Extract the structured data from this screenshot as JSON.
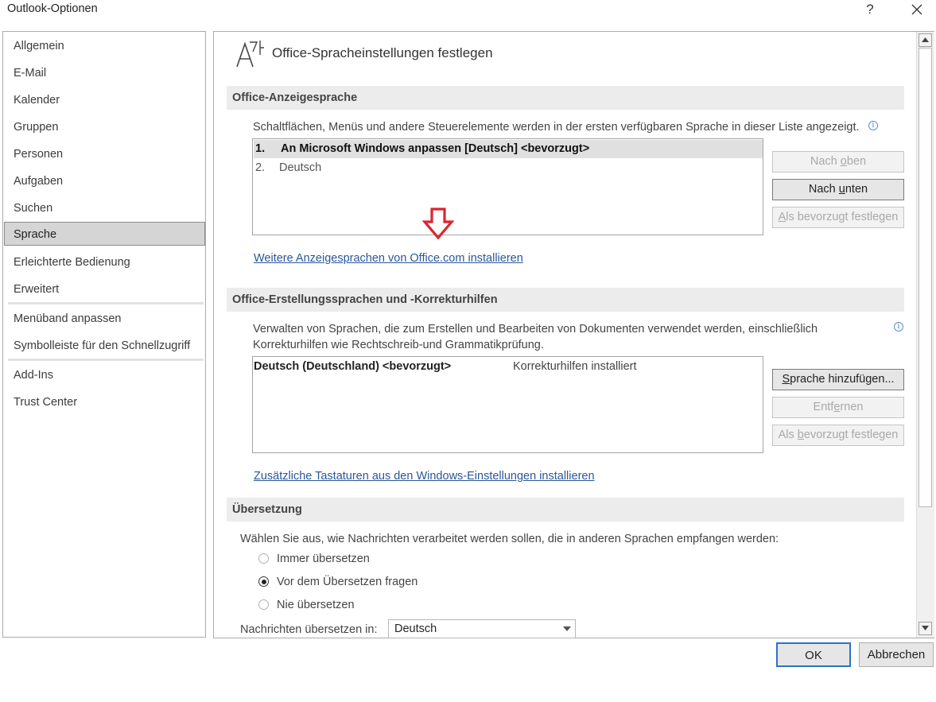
{
  "window": {
    "title": "Outlook-Optionen",
    "help_label": "?",
    "close_label": "✕"
  },
  "sidebar": {
    "items": [
      {
        "label": "Allgemein"
      },
      {
        "label": "E-Mail"
      },
      {
        "label": "Kalender"
      },
      {
        "label": "Gruppen"
      },
      {
        "label": "Personen"
      },
      {
        "label": "Aufgaben"
      },
      {
        "label": "Suchen"
      },
      {
        "label": "Sprache",
        "selected": true
      },
      {
        "label": "Erleichterte Bedienung"
      },
      {
        "label": "Erweitert"
      },
      {
        "label": "Menüband anpassen"
      },
      {
        "label": "Symbolleiste für den Schnellzugriff"
      },
      {
        "label": "Add-Ins"
      },
      {
        "label": "Trust Center"
      }
    ]
  },
  "page": {
    "icon": "language-icon",
    "icon_glyph": "A",
    "icon_glyph2": "ᄀ",
    "title": "Office-Spracheinstellungen festlegen"
  },
  "display_language": {
    "header": "Office-Anzeigesprache",
    "description": "Schaltflächen, Menüs und andere Steuerelemente werden in der ersten verfügbaren Sprache in dieser Liste angezeigt.",
    "info_glyph": "i",
    "list": [
      {
        "num": "1.",
        "label": "An Microsoft Windows anpassen [Deutsch] <bevorzugt>",
        "selected": true
      },
      {
        "num": "2.",
        "label": "Deutsch"
      }
    ],
    "btn_up": {
      "pre": "Nach ",
      "acc": "o",
      "post": "ben"
    },
    "btn_down": {
      "pre": "Nach ",
      "acc": "u",
      "post": "nten"
    },
    "btn_preferred": {
      "pre": "",
      "acc": "A",
      "post": "ls bevorzugt festlegen"
    },
    "link": "Weitere Anzeigesprachen von Office.com installieren",
    "arrow_color": "#d9262e"
  },
  "authoring_language": {
    "header": "Office-Erstellungssprachen und -Korrekturhilfen",
    "description_line1": "Verwalten von Sprachen, die zum Erstellen und Bearbeiten von Dokumenten verwendet werden, einschließlich",
    "description_line2": "Korrekturhilfen wie Rechtschreib-und Grammatikprüfung.",
    "list": [
      {
        "language": "Deutsch (Deutschland) <bevorzugt>",
        "status": "Korrekturhilfen installiert"
      }
    ],
    "btn_add": {
      "pre": "",
      "acc": "S",
      "post": "prache hinzufügen..."
    },
    "btn_remove": {
      "pre": "Entf",
      "acc": "e",
      "post": "rnen"
    },
    "btn_preferred": {
      "pre": "Als ",
      "acc": "b",
      "post": "evorzugt festlegen"
    },
    "link": "Zusätzliche Tastaturen aus den Windows-Einstellungen installieren"
  },
  "translation": {
    "header": "Übersetzung",
    "description": "Wählen Sie aus, wie Nachrichten verarbeitet werden sollen, die in anderen Sprachen empfangen werden:",
    "options": [
      {
        "label": "Immer übersetzen",
        "checked": false
      },
      {
        "label": "Vor dem Übersetzen fragen",
        "checked": true
      },
      {
        "label": "Nie übersetzen",
        "checked": false
      }
    ],
    "target_label": "Nachrichten übersetzen in:",
    "target_value": "Deutsch"
  },
  "footer": {
    "ok_label": "OK",
    "cancel_label": "Abbrechen"
  }
}
